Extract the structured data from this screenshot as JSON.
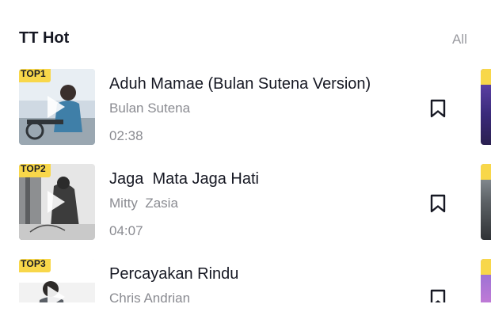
{
  "section": {
    "title": "TT Hot",
    "all_label": "All"
  },
  "songs": [
    {
      "rank": "TOP1",
      "title": "Aduh Mamae (Bulan Sutena Version)",
      "artist": "Bulan Sutena",
      "duration": "02:38"
    },
    {
      "rank": "TOP2",
      "title": "Jaga  Mata Jaga Hati",
      "artist": "Mitty  Zasia",
      "duration": "04:07"
    },
    {
      "rank": "TOP3",
      "title": "Percayakan Rindu",
      "artist": "Chris Andrian",
      "duration": ""
    }
  ],
  "colors": {
    "badge": "#f8d74a",
    "text_primary": "#161823",
    "text_secondary": "#8a8b91"
  },
  "icons": {
    "play": "play-icon",
    "bookmark": "bookmark-icon"
  }
}
